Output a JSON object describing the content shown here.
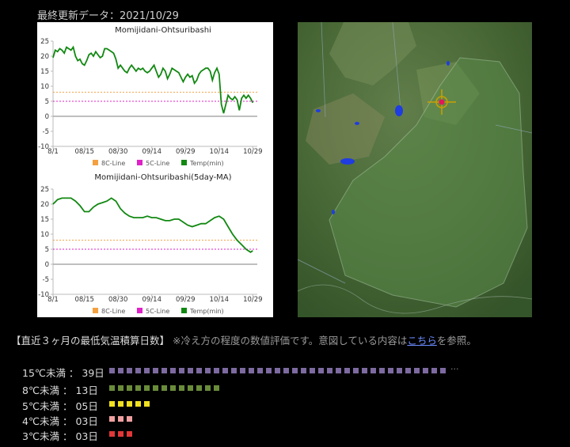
{
  "header": {
    "updated": "最終更新データ：2021/10/29"
  },
  "charts": [
    {
      "chart_data": {
        "type": "line",
        "title": "Momijidani-Ohtsuribashi",
        "x_ticks": [
          "8/1",
          "08/15",
          "08/30",
          "09/14",
          "09/29",
          "10/14",
          "10/29"
        ],
        "y_ticks": [
          "25",
          "20",
          "15",
          "10",
          "5",
          "0",
          "-5",
          "-10"
        ],
        "ylim": [
          -10,
          25
        ],
        "xlim": [
          "2021-08-01",
          "2021-10-31"
        ],
        "lines": [
          {
            "name": "8C-Line",
            "y": 8,
            "color": "#f5a040"
          },
          {
            "name": "5C-Line",
            "y": 5,
            "color": "#e020c8"
          }
        ],
        "series": [
          {
            "name": "Temp(min)",
            "color": "#118811",
            "x": [
              "2021-08-01",
              "2021-08-02",
              "2021-08-03",
              "2021-08-04",
              "2021-08-05",
              "2021-08-06",
              "2021-08-07",
              "2021-08-08",
              "2021-08-09",
              "2021-08-10",
              "2021-08-11",
              "2021-08-12",
              "2021-08-13",
              "2021-08-14",
              "2021-08-15",
              "2021-08-16",
              "2021-08-17",
              "2021-08-18",
              "2021-08-19",
              "2021-08-20",
              "2021-08-21",
              "2021-08-22",
              "2021-08-23",
              "2021-08-24",
              "2021-08-25",
              "2021-08-26",
              "2021-08-27",
              "2021-08-28",
              "2021-08-29",
              "2021-08-30",
              "2021-08-31",
              "2021-09-01",
              "2021-09-02",
              "2021-09-03",
              "2021-09-04",
              "2021-09-05",
              "2021-09-06",
              "2021-09-07",
              "2021-09-08",
              "2021-09-09",
              "2021-09-10",
              "2021-09-11",
              "2021-09-12",
              "2021-09-13",
              "2021-09-14",
              "2021-09-15",
              "2021-09-16",
              "2021-09-17",
              "2021-09-18",
              "2021-09-19",
              "2021-09-20",
              "2021-09-21",
              "2021-09-22",
              "2021-09-23",
              "2021-09-24",
              "2021-09-25",
              "2021-09-26",
              "2021-09-27",
              "2021-09-28",
              "2021-09-29",
              "2021-09-30",
              "2021-10-01",
              "2021-10-02",
              "2021-10-03",
              "2021-10-04",
              "2021-10-05",
              "2021-10-06",
              "2021-10-07",
              "2021-10-08",
              "2021-10-09",
              "2021-10-10",
              "2021-10-11",
              "2021-10-12",
              "2021-10-13",
              "2021-10-14",
              "2021-10-15",
              "2021-10-16",
              "2021-10-17",
              "2021-10-18",
              "2021-10-19",
              "2021-10-20",
              "2021-10-21",
              "2021-10-22",
              "2021-10-23",
              "2021-10-24",
              "2021-10-25",
              "2021-10-26",
              "2021-10-27",
              "2021-10-28",
              "2021-10-29"
            ],
            "values": [
              19.5,
              22,
              21.5,
              22.5,
              22,
              21,
              23,
              22.5,
              22,
              23,
              20,
              18.5,
              19,
              17.5,
              17,
              18.5,
              20.5,
              21,
              20,
              21.5,
              20.5,
              19.5,
              20,
              22.5,
              22.5,
              22,
              21.5,
              21,
              19,
              16,
              17,
              16,
              15,
              14.5,
              16,
              17,
              16,
              15,
              16,
              15.5,
              16,
              15,
              14.5,
              15,
              16,
              17,
              15,
              13,
              14,
              16,
              15,
              12.5,
              14,
              16,
              15.5,
              15,
              14.5,
              13,
              11.5,
              13,
              14,
              13,
              13.5,
              11,
              12,
              14,
              15,
              15.5,
              16,
              16,
              15,
              12,
              14.5,
              16,
              14,
              4,
              1,
              4,
              7,
              6,
              5.5,
              6.5,
              5.5,
              2,
              6,
              7,
              6,
              7,
              6,
              4.5
            ]
          }
        ]
      }
    },
    {
      "chart_data": {
        "type": "line",
        "title": "Momijidani-Ohtsuribashi(5day-MA)",
        "x_ticks": [
          "8/1",
          "08/15",
          "08/30",
          "09/14",
          "09/29",
          "10/14",
          "10/29"
        ],
        "y_ticks": [
          "25",
          "20",
          "15",
          "10",
          "5",
          "0",
          "-5",
          "-10"
        ],
        "ylim": [
          -10,
          25
        ],
        "xlim": [
          "2021-08-01",
          "2021-10-31"
        ],
        "lines": [
          {
            "name": "8C-Line",
            "y": 8,
            "color": "#f5a040"
          },
          {
            "name": "5C-Line",
            "y": 5,
            "color": "#e020c8"
          }
        ],
        "series": [
          {
            "name": "Temp(min)",
            "color": "#118811",
            "x": [
              "2021-08-01",
              "2021-08-03",
              "2021-08-05",
              "2021-08-07",
              "2021-08-09",
              "2021-08-11",
              "2021-08-13",
              "2021-08-15",
              "2021-08-17",
              "2021-08-19",
              "2021-08-21",
              "2021-08-23",
              "2021-08-25",
              "2021-08-27",
              "2021-08-29",
              "2021-08-31",
              "2021-09-02",
              "2021-09-04",
              "2021-09-06",
              "2021-09-08",
              "2021-09-10",
              "2021-09-12",
              "2021-09-14",
              "2021-09-16",
              "2021-09-18",
              "2021-09-20",
              "2021-09-22",
              "2021-09-24",
              "2021-09-26",
              "2021-09-28",
              "2021-09-30",
              "2021-10-02",
              "2021-10-04",
              "2021-10-06",
              "2021-10-08",
              "2021-10-10",
              "2021-10-12",
              "2021-10-14",
              "2021-10-16",
              "2021-10-18",
              "2021-10-20",
              "2021-10-22",
              "2021-10-24",
              "2021-10-26",
              "2021-10-28",
              "2021-10-29"
            ],
            "values": [
              20,
              21.5,
              22,
              22,
              22,
              21,
              19.5,
              17.5,
              17.5,
              19,
              20,
              20.5,
              21,
              22,
              21,
              18.5,
              17,
              16,
              15.5,
              15.5,
              15.5,
              16,
              15.5,
              15.5,
              15,
              14.5,
              14.5,
              15,
              15,
              14,
              13,
              12.5,
              13,
              13.5,
              13.5,
              14.5,
              15.5,
              16,
              15,
              12.5,
              10,
              8,
              6.5,
              5,
              4,
              4.5
            ]
          }
        ]
      }
    }
  ],
  "legend": [
    {
      "label": "8C-Line",
      "color": "#f5a040"
    },
    {
      "label": "5C-Line",
      "color": "#e020c8"
    },
    {
      "label": "Temp(min)",
      "color": "#118811"
    }
  ],
  "summary": {
    "title": "【直近３ヶ月の最低気温積算日数】",
    "note_before": " ※冷え方の程度の数値評価です。意図している内容は",
    "link_text": "こちら",
    "note_after": "を参照。",
    "rows": [
      {
        "label": "15℃未満 ： 39日",
        "squares": 39,
        "color": "#7d6aa0",
        "ellipsis": "···"
      },
      {
        "label": "8℃未満 ： 13日",
        "squares": 13,
        "color": "#6a8c3a",
        "ellipsis": ""
      },
      {
        "label": "5℃未満 ： 05日",
        "squares": 5,
        "color": "#f0e020",
        "ellipsis": ""
      },
      {
        "label": "4℃未満 ： 03日",
        "squares": 3,
        "color": "#f0a0a0",
        "ellipsis": ""
      },
      {
        "label": "3℃未満 ： 03日",
        "squares": 3,
        "color": "#e03838",
        "ellipsis": ""
      }
    ]
  }
}
